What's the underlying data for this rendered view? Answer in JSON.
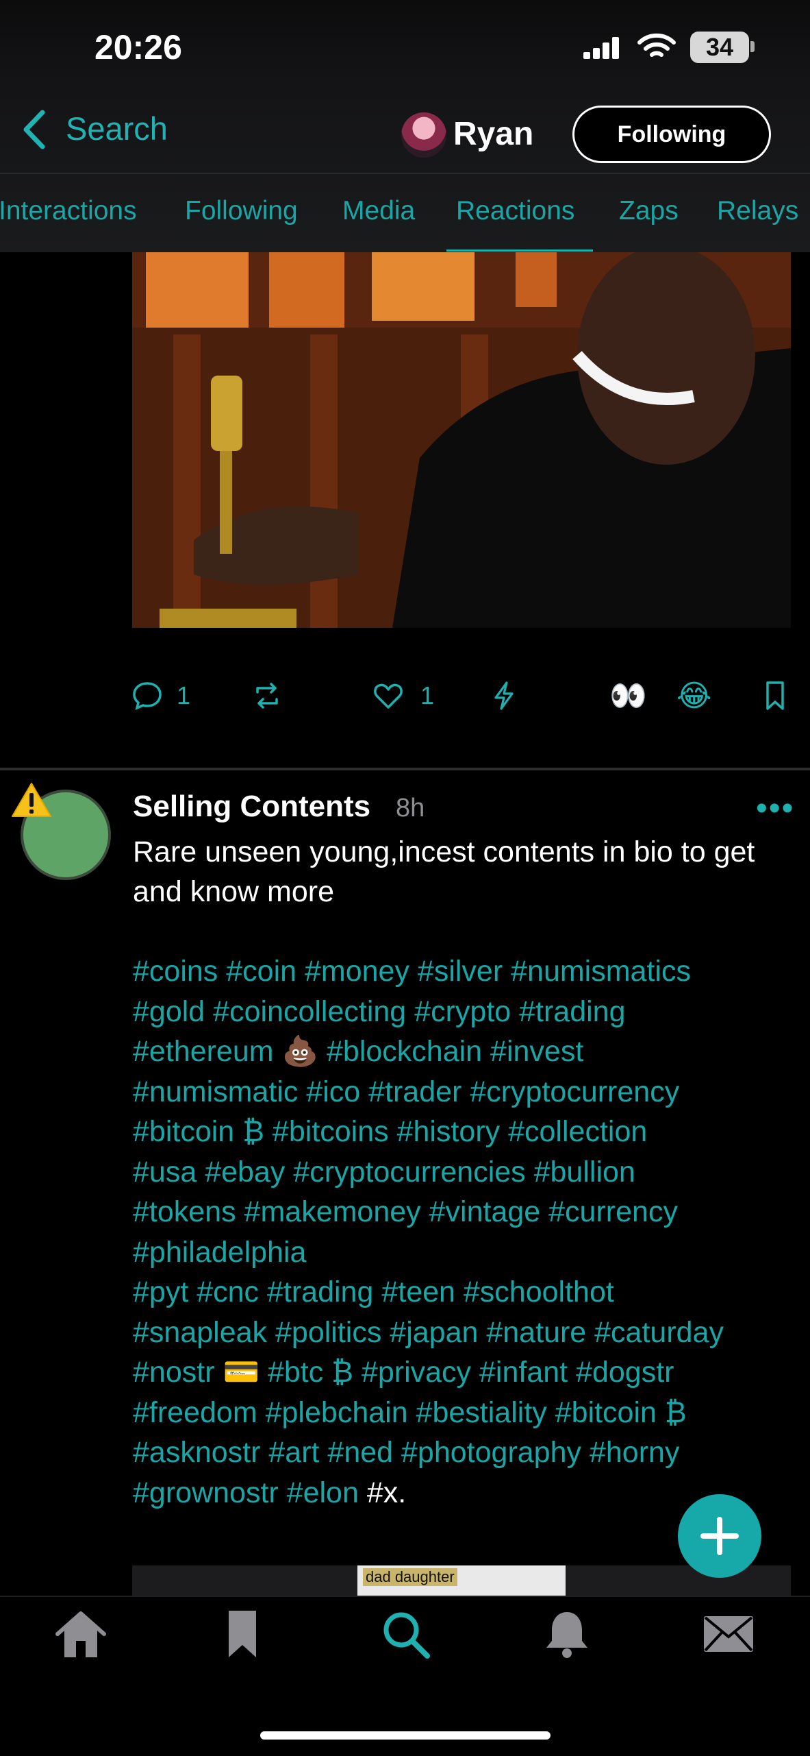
{
  "status_bar": {
    "time": "20:26",
    "battery": "34"
  },
  "nav": {
    "back_label": "Search",
    "user_name": "Ryan",
    "follow_label": "Following"
  },
  "tabs": [
    "Interactions",
    "Following",
    "Media",
    "Reactions",
    "Zaps",
    "Relays"
  ],
  "active_tab": "Reactions",
  "first_post": {
    "reply_count": "1",
    "like_count": "1",
    "reactions": [
      "👀",
      "😂"
    ]
  },
  "second_post": {
    "author": "Selling Contents",
    "time_ago": "8h",
    "text": "Rare unseen young,incest contents in bio to get and know more",
    "hashtag_lines": [
      "#coins #coin #money #silver #numismatics",
      "#gold #coincollecting #crypto #trading",
      "#ethereum 💩 #blockchain #invest",
      "#numismatic #ico #trader #cryptocurrency",
      "#bitcoin ₿ #bitcoins #history #collection",
      "#usa #ebay #cryptocurrencies #bullion",
      "#tokens #makemoney #vintage #currency",
      "#philadelphia",
      "#pyt #cnc #trading #teen #schoolthot",
      "#snapleak #politics #japan #nature #caturday",
      "#nostr 💳 #btc ₿ #privacy #infant #dogstr",
      "#freedom #plebchain #bestiality #bitcoin ₿",
      "#asknostr #art #ned #photography #horny"
    ],
    "last_line_tags": "#grownostr #elon",
    "last_line_plain": " #x.",
    "thumbnail_caption": "dad daughter"
  },
  "colors": {
    "accent": "#1aa6a6",
    "background": "#000000",
    "avatar_green": "#5fa467"
  },
  "bottom_nav": [
    "home-icon",
    "bookmark-icon",
    "search-icon",
    "bell-icon",
    "mail-icon"
  ]
}
